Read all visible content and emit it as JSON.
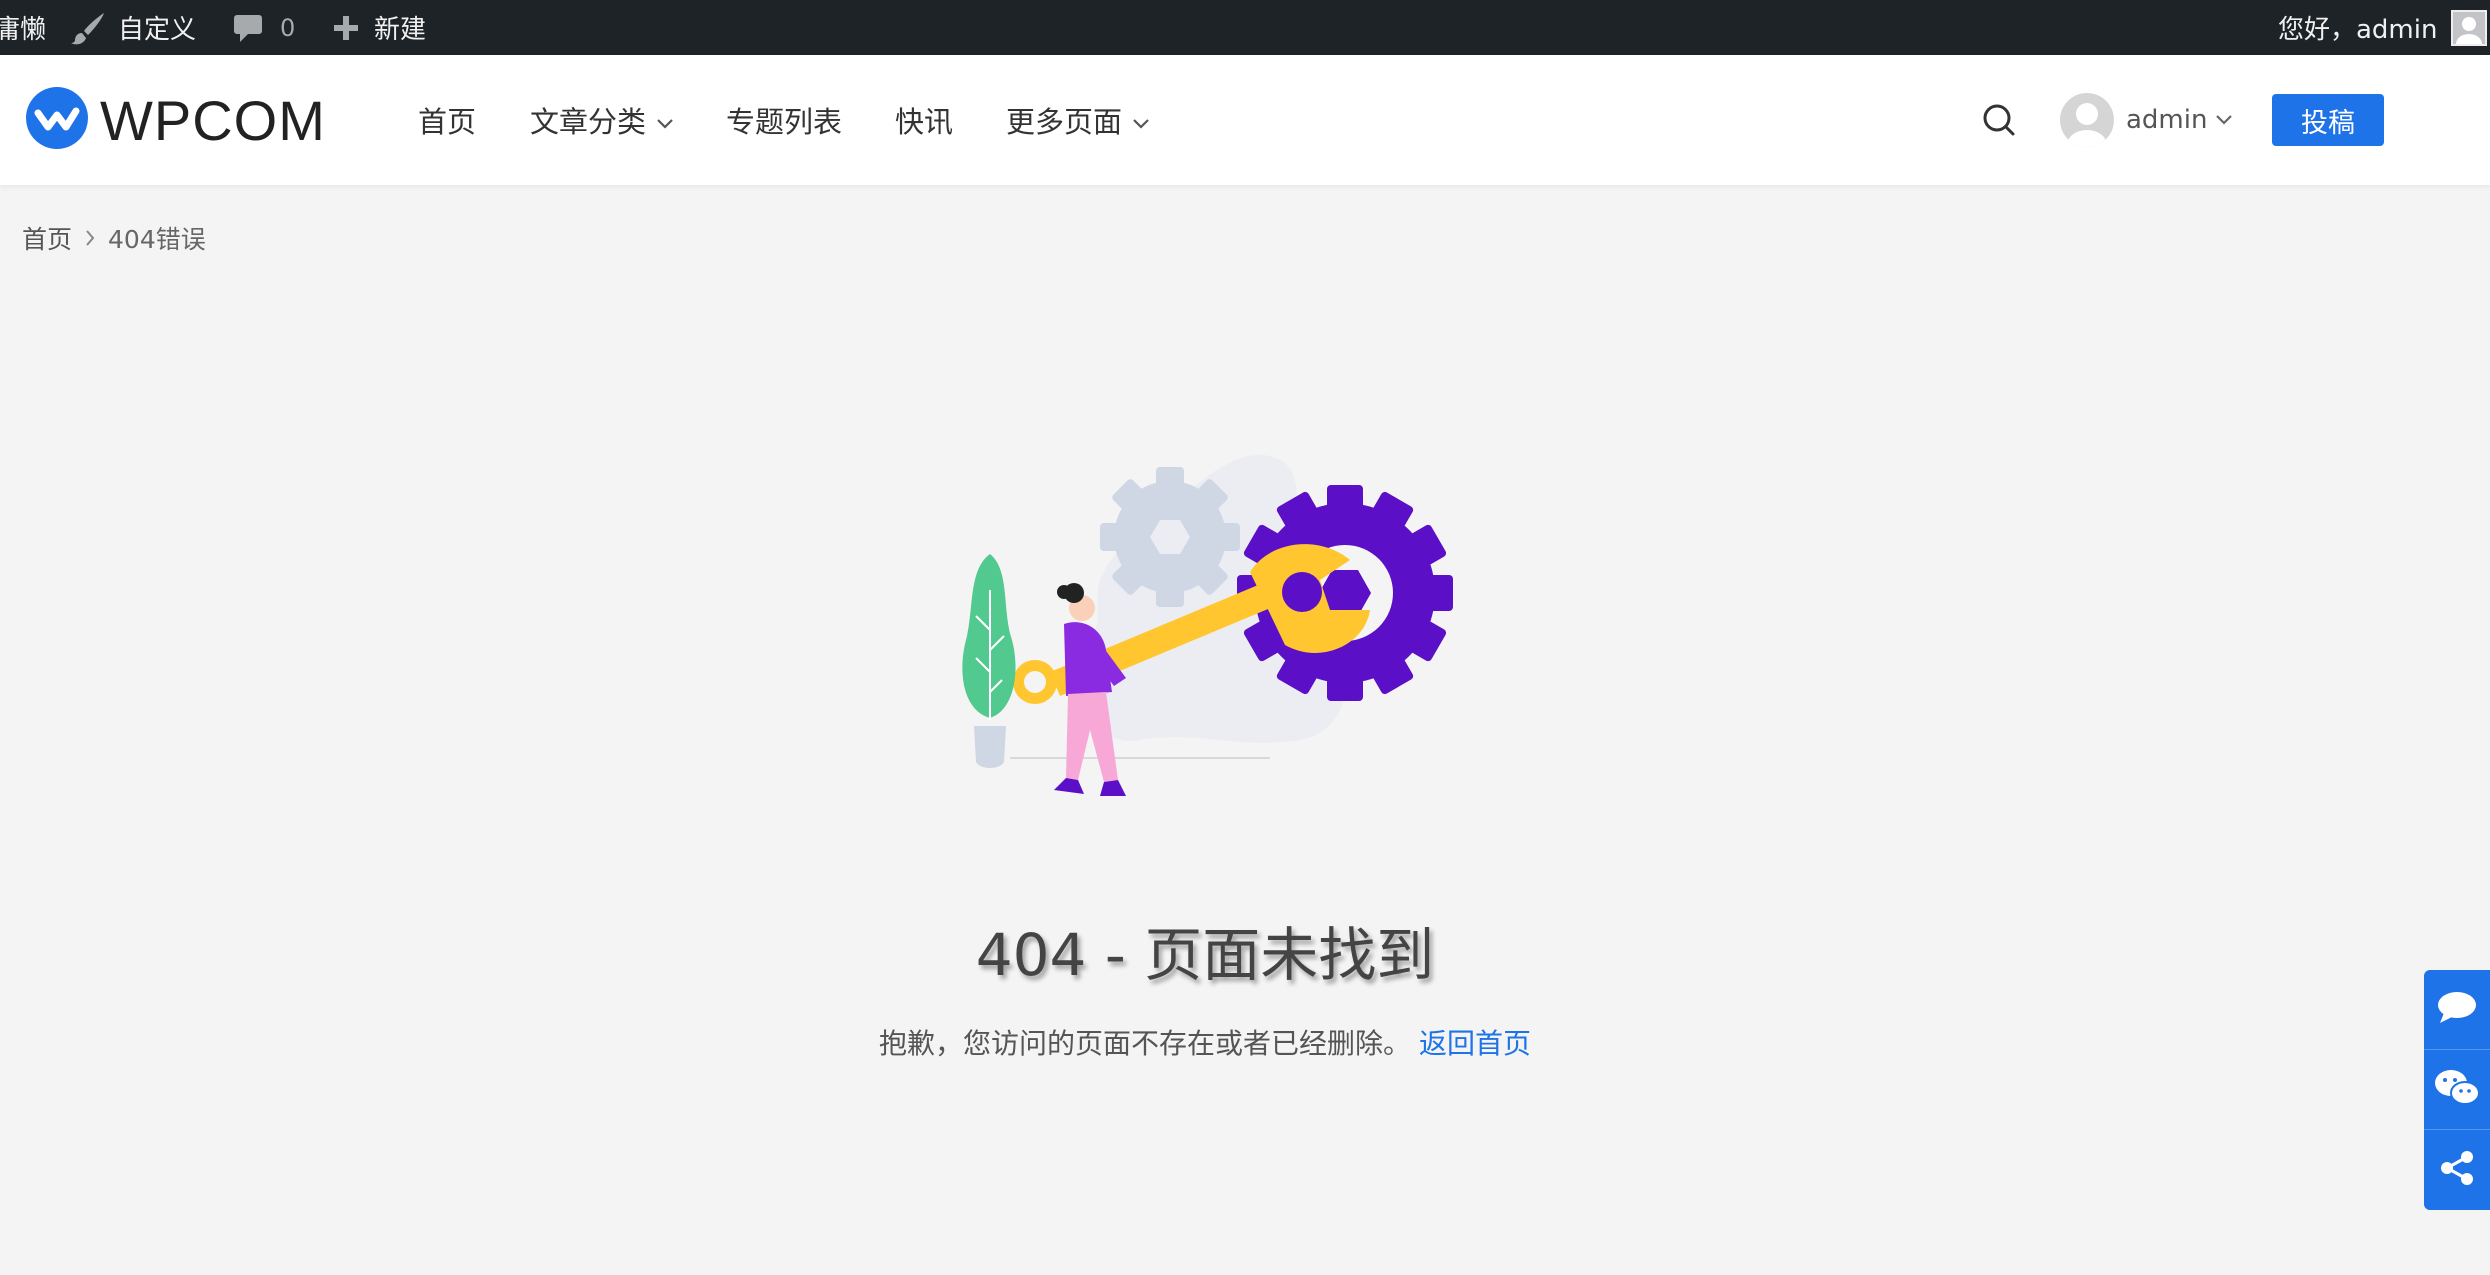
{
  "adminbar": {
    "site_label": "庸懒",
    "customize_label": "自定义",
    "comments_count": "0",
    "new_label": "新建",
    "greeting": "您好，admin"
  },
  "header": {
    "logo_text": "WPCOM",
    "nav": [
      {
        "label": "首页",
        "dropdown": false
      },
      {
        "label": "文章分类",
        "dropdown": true
      },
      {
        "label": "专题列表",
        "dropdown": false
      },
      {
        "label": "快讯",
        "dropdown": false
      },
      {
        "label": "更多页面",
        "dropdown": true
      }
    ],
    "user_name": "admin",
    "post_button": "投稿"
  },
  "breadcrumb": {
    "home": "首页",
    "current": "404错误"
  },
  "error": {
    "title": "404 - 页面未找到",
    "description": "抱歉，您访问的页面不存在或者已经删除。",
    "home_link": "返回首页"
  },
  "icons": {
    "comment": "comment-icon",
    "wechat": "wechat-icon",
    "share": "share-icon",
    "search": "search-icon",
    "brush": "brush-icon",
    "plus": "plus-icon"
  },
  "colors": {
    "accent": "#1e73e8",
    "adminbar_bg": "#1d2327",
    "gear_purple": "#5b0fc7",
    "wrench_yellow": "#ffc62f",
    "gear_grey": "#cfd6e4",
    "plant_green": "#52c98e"
  }
}
